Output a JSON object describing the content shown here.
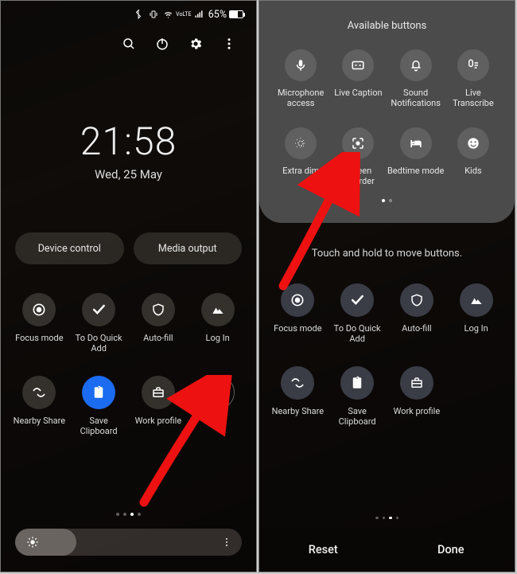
{
  "status": {
    "battery_text": "65%"
  },
  "left": {
    "clock": {
      "time": "21:58",
      "date": "Wed, 25 May"
    },
    "pills": {
      "device_control": "Device control",
      "media_output": "Media output"
    },
    "tiles": [
      {
        "label": "Focus mode"
      },
      {
        "label": "To Do Quick Add"
      },
      {
        "label": "Auto-fill"
      },
      {
        "label": "Log In"
      },
      {
        "label": "Nearby Share"
      },
      {
        "label": "Save Clipboard"
      },
      {
        "label": "Work profile"
      },
      {
        "label": ""
      }
    ]
  },
  "right": {
    "panel_title": "Available buttons",
    "panel_tiles": [
      {
        "label": "Microphone access"
      },
      {
        "label": "Live Caption"
      },
      {
        "label": "Sound Notifications"
      },
      {
        "label": "Live Transcribe"
      },
      {
        "label": "Extra dim"
      },
      {
        "label": "Screen recorder"
      },
      {
        "label": "Bedtime mode"
      },
      {
        "label": "Kids"
      }
    ],
    "hint": "Touch and hold to move buttons.",
    "tiles": [
      {
        "label": "Focus mode"
      },
      {
        "label": "To Do Quick Add"
      },
      {
        "label": "Auto-fill"
      },
      {
        "label": "Log In"
      },
      {
        "label": "Nearby Share"
      },
      {
        "label": "Save Clipboard"
      },
      {
        "label": "Work profile"
      }
    ],
    "buttons": {
      "reset": "Reset",
      "done": "Done"
    }
  }
}
